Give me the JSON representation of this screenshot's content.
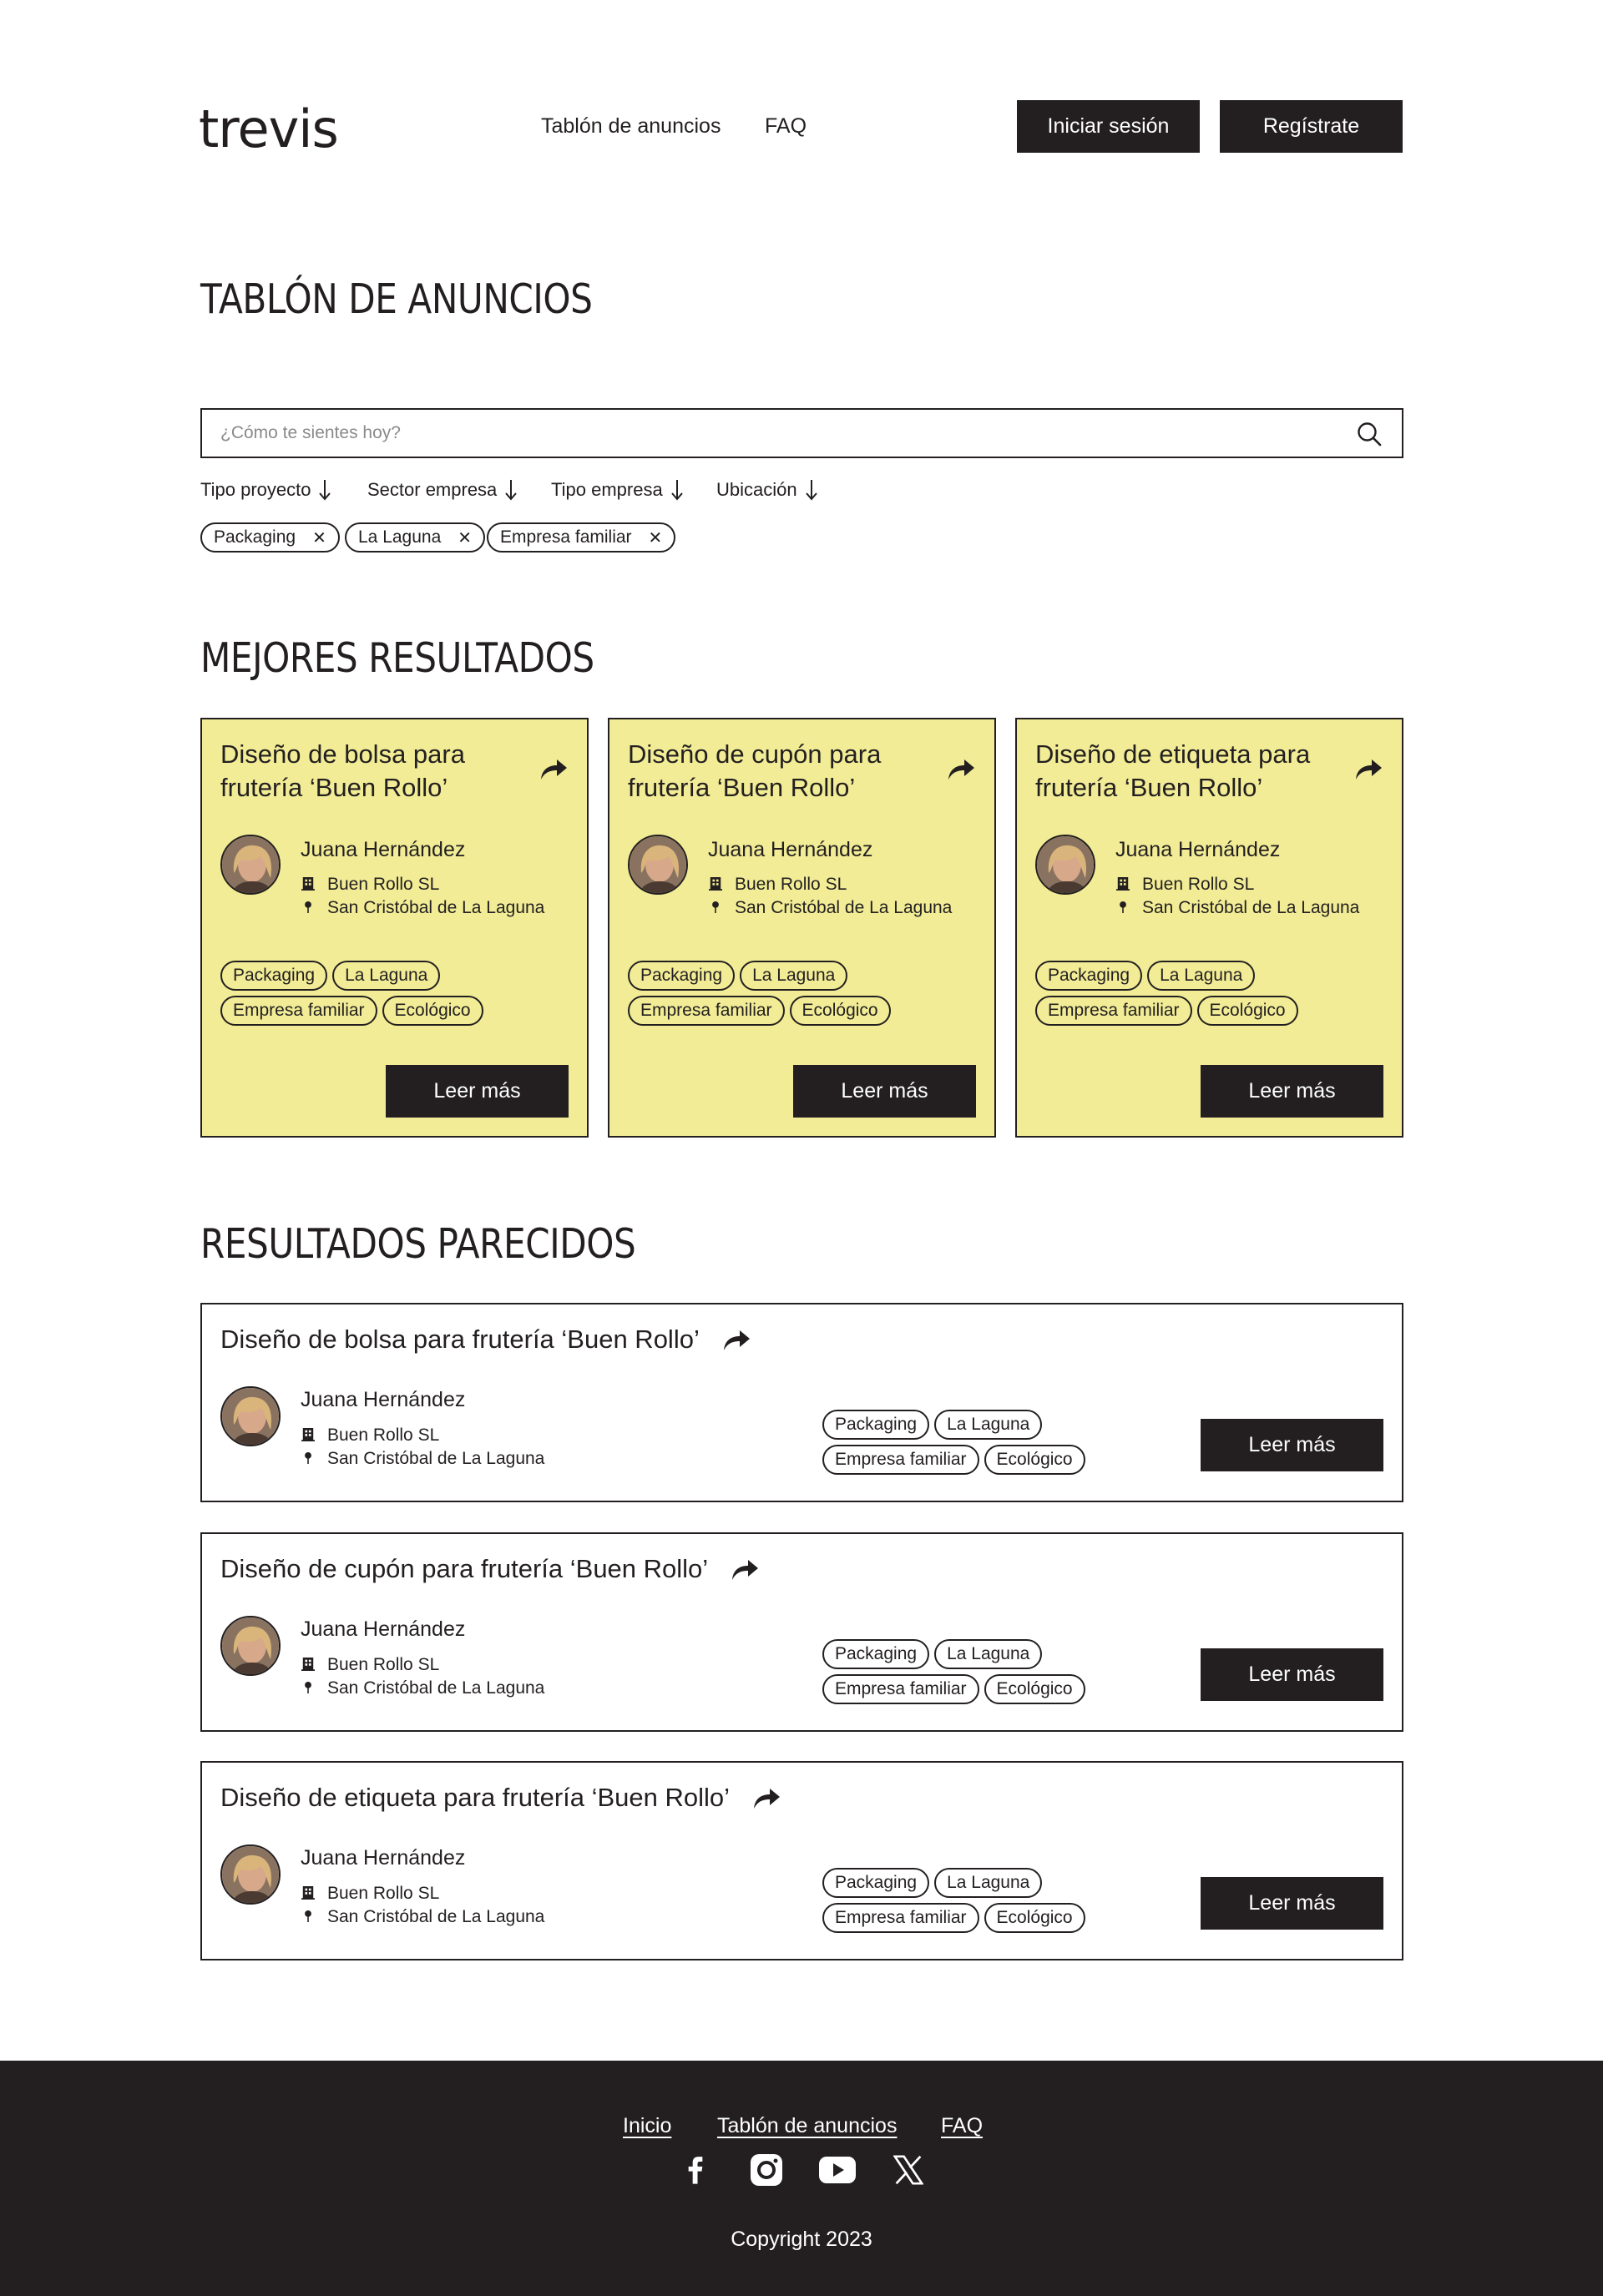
{
  "header": {
    "logo": "trevis",
    "nav": [
      "Tablón de anuncios",
      "FAQ"
    ],
    "login": "Iniciar sesión",
    "signup": "Regístrate"
  },
  "board": {
    "title": "TABLÓN DE ANUNCIOS",
    "search_placeholder": "¿Cómo te sientes hoy?",
    "filters": [
      "Tipo proyecto",
      "Sector empresa",
      "Tipo empresa",
      "Ubicación"
    ],
    "active_chips": [
      "Packaging",
      "La Laguna",
      "Empresa familiar"
    ]
  },
  "best": {
    "title": "MEJORES RESULTADOS",
    "cards": [
      {
        "title": "Diseño de bolsa para frutería ‘Buen Rollo’",
        "person": "Juana Hernández",
        "company": "Buen Rollo SL",
        "location": "San Cristóbal de La Laguna",
        "tags": [
          "Packaging",
          "La Laguna",
          "Empresa familiar",
          "Ecológico"
        ],
        "button": "Leer más"
      },
      {
        "title": "Diseño de cupón para frutería ‘Buen Rollo’",
        "person": "Juana Hernández",
        "company": "Buen Rollo SL",
        "location": "San Cristóbal de La Laguna",
        "tags": [
          "Packaging",
          "La Laguna",
          "Empresa familiar",
          "Ecológico"
        ],
        "button": "Leer más"
      },
      {
        "title": "Diseño de etiqueta para frutería ‘Buen Rollo’",
        "person": "Juana Hernández",
        "company": "Buen Rollo SL",
        "location": "San Cristóbal de La Laguna",
        "tags": [
          "Packaging",
          "La Laguna",
          "Empresa familiar",
          "Ecológico"
        ],
        "button": "Leer más"
      }
    ]
  },
  "similar": {
    "title": "RESULTADOS PARECIDOS",
    "rows": [
      {
        "title": "Diseño de bolsa para frutería ‘Buen Rollo’",
        "person": "Juana Hernández",
        "company": "Buen Rollo SL",
        "location": "San Cristóbal de La Laguna",
        "tags": [
          "Packaging",
          "La Laguna",
          "Empresa familiar",
          "Ecológico"
        ],
        "button": "Leer más"
      },
      {
        "title": "Diseño de cupón para frutería ‘Buen Rollo’",
        "person": "Juana Hernández",
        "company": "Buen Rollo SL",
        "location": "San Cristóbal de La Laguna",
        "tags": [
          "Packaging",
          "La Laguna",
          "Empresa familiar",
          "Ecológico"
        ],
        "button": "Leer más"
      },
      {
        "title": "Diseño de etiqueta para frutería ‘Buen Rollo’",
        "person": "Juana Hernández",
        "company": "Buen Rollo SL",
        "location": "San Cristóbal de La Laguna",
        "tags": [
          "Packaging",
          "La Laguna",
          "Empresa familiar",
          "Ecológico"
        ],
        "button": "Leer más"
      }
    ]
  },
  "footer": {
    "links": [
      "Inicio",
      "Tablón de anuncios",
      "FAQ"
    ],
    "social": [
      "facebook-icon",
      "instagram-icon",
      "youtube-icon",
      "x-icon"
    ],
    "copyright": "Copyright 2023"
  },
  "colors": {
    "dark": "#231f20",
    "card_yellow": "#f1ec95",
    "white": "#ffffff"
  }
}
